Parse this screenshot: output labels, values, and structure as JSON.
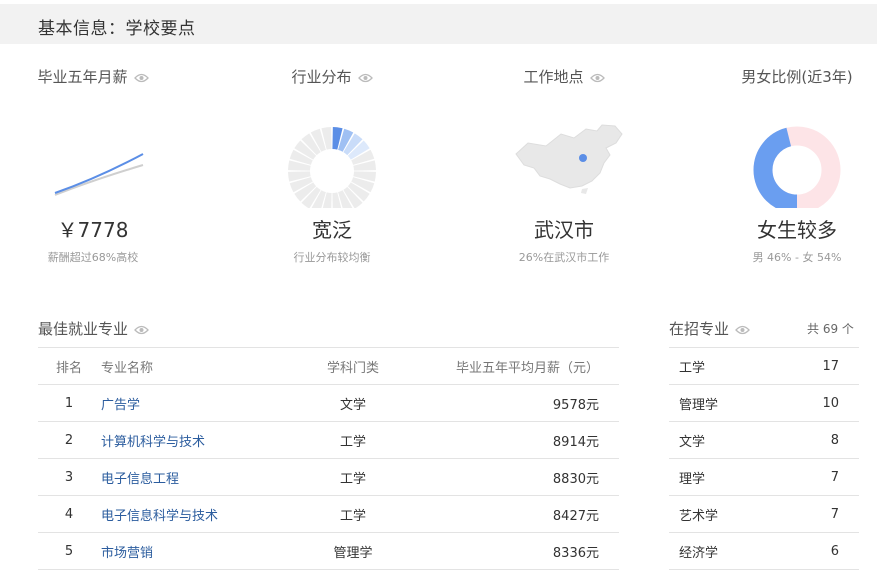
{
  "header": {
    "title": "基本信息：学校要点"
  },
  "stats": [
    {
      "title": "毕业五年月薪",
      "value": "￥7778",
      "sub": "薪酬超过68%高校"
    },
    {
      "title": "行业分布",
      "value": "宽泛",
      "sub": "行业分布较均衡"
    },
    {
      "title": "工作地点",
      "value": "武汉市",
      "sub": "26%在武汉市工作"
    },
    {
      "title": "男女比例(近3年)",
      "value": "女生较多",
      "sub": "男 46% - 女 54%"
    }
  ],
  "gender": {
    "male_pct": 46,
    "female_pct": 54
  },
  "colors": {
    "accent": "#6a9ef0",
    "accent_light": "#cfe0fb",
    "female": "#fde4e7",
    "map": "#e8e8e8"
  },
  "best_majors": {
    "title": "最佳就业专业",
    "columns": {
      "rank": "排名",
      "name": "专业名称",
      "category": "学科门类",
      "salary": "毕业五年平均月薪（元）"
    },
    "rows": [
      {
        "rank": "1",
        "name": "广告学",
        "category": "文学",
        "salary": "9578元"
      },
      {
        "rank": "2",
        "name": "计算机科学与技术",
        "category": "工学",
        "salary": "8914元"
      },
      {
        "rank": "3",
        "name": "电子信息工程",
        "category": "工学",
        "salary": "8830元"
      },
      {
        "rank": "4",
        "name": "电子信息科学与技术",
        "category": "工学",
        "salary": "8427元"
      },
      {
        "rank": "5",
        "name": "市场营销",
        "category": "管理学",
        "salary": "8336元"
      }
    ]
  },
  "recruiting": {
    "title": "在招专业",
    "count_label": "共 69 个",
    "rows": [
      {
        "name": "工学",
        "count": "17"
      },
      {
        "name": "管理学",
        "count": "10"
      },
      {
        "name": "文学",
        "count": "8"
      },
      {
        "name": "理学",
        "count": "7"
      },
      {
        "name": "艺术学",
        "count": "7"
      },
      {
        "name": "经济学",
        "count": "6"
      }
    ]
  }
}
